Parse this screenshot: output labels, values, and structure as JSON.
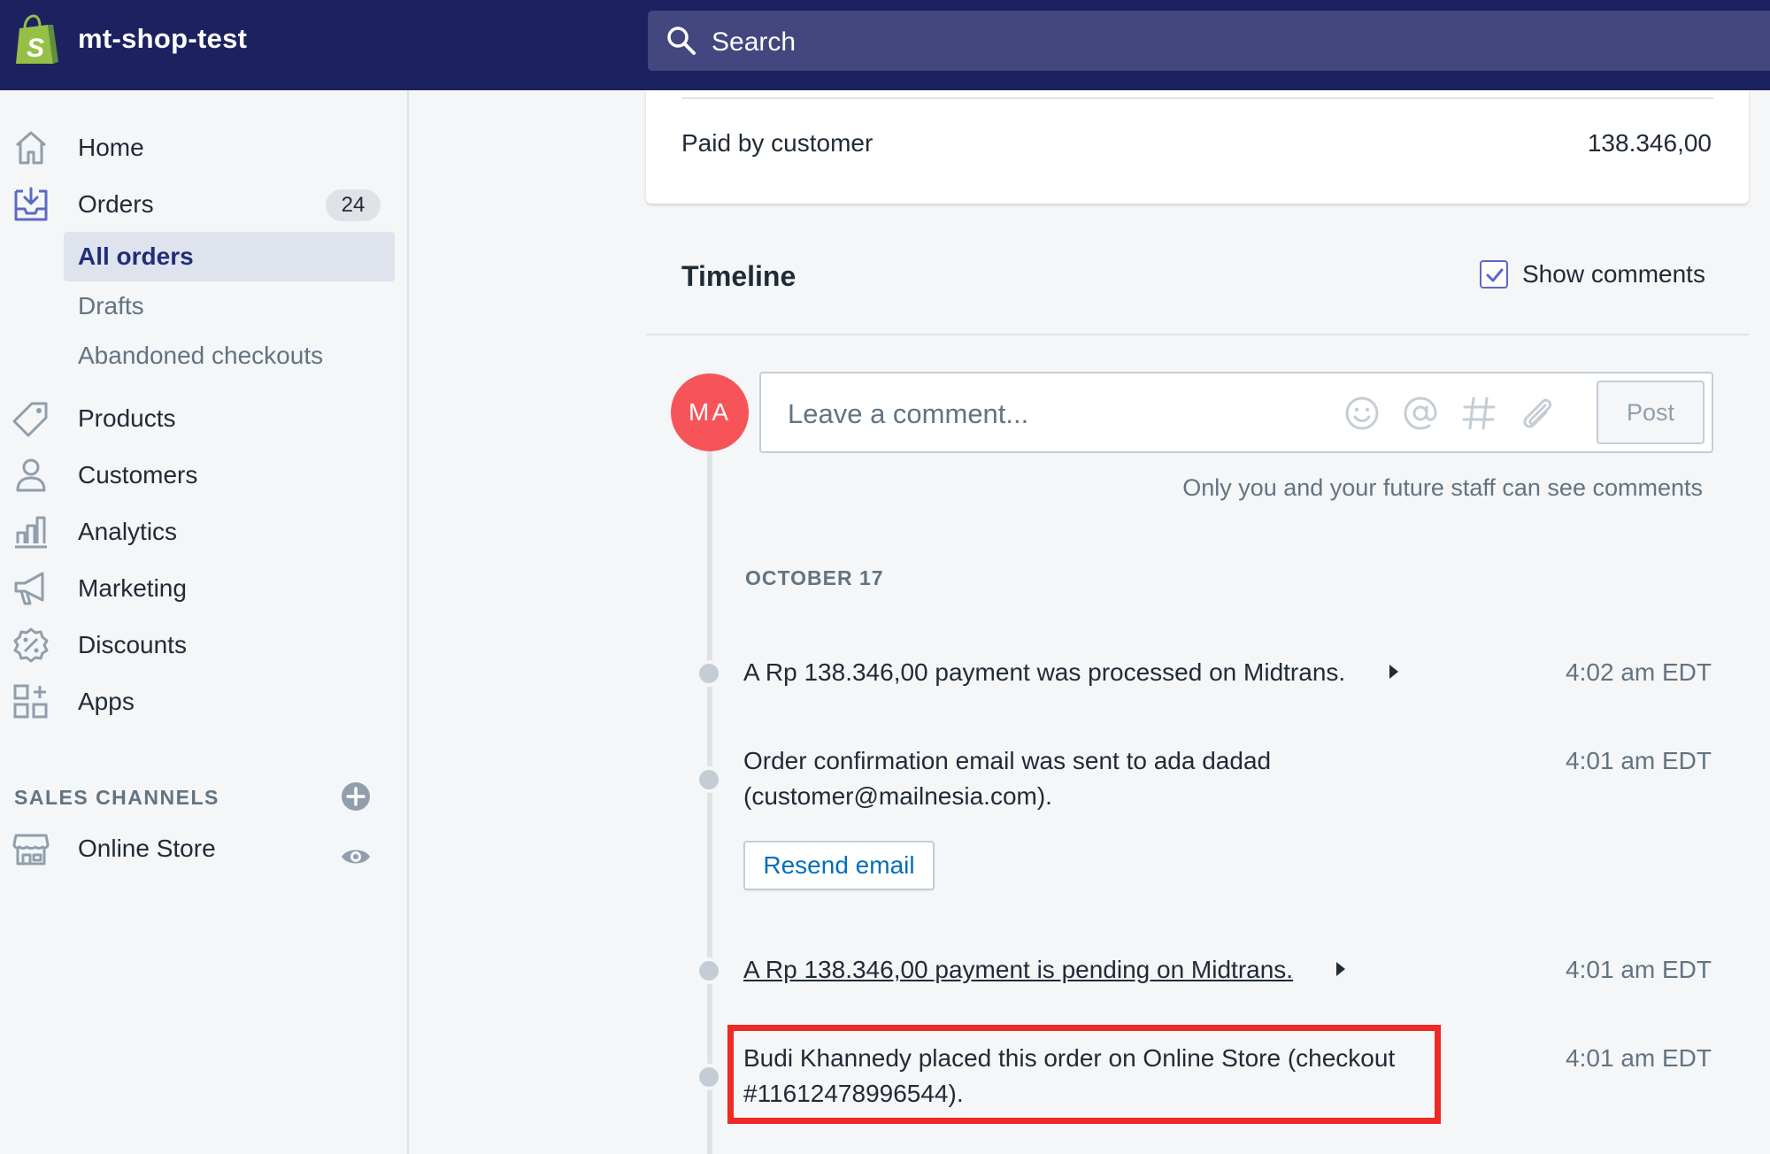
{
  "topbar": {
    "shop_name": "mt-shop-test",
    "search_placeholder": "Search",
    "logo_icon": "shopify-bag-icon"
  },
  "sidebar": {
    "items": [
      {
        "label": "Home",
        "icon": "home-icon"
      },
      {
        "label": "Orders",
        "icon": "orders-inbox-icon",
        "badge": "24"
      },
      {
        "label": "Products",
        "icon": "tag-icon"
      },
      {
        "label": "Customers",
        "icon": "person-icon"
      },
      {
        "label": "Analytics",
        "icon": "bar-chart-icon"
      },
      {
        "label": "Marketing",
        "icon": "megaphone-icon"
      },
      {
        "label": "Discounts",
        "icon": "discount-icon"
      },
      {
        "label": "Apps",
        "icon": "apps-grid-icon"
      }
    ],
    "orders_sub": [
      {
        "label": "All orders",
        "active": true
      },
      {
        "label": "Drafts",
        "active": false
      },
      {
        "label": "Abandoned checkouts",
        "active": false
      }
    ],
    "sales_channels_title": "SALES CHANNELS",
    "online_store": "Online Store"
  },
  "payment_card": {
    "paid_label": "Paid by customer",
    "paid_value": "138.346,00"
  },
  "timeline": {
    "title": "Timeline",
    "show_comments_label": "Show comments",
    "show_comments_checked": true,
    "avatar_initials": "MA",
    "comment_placeholder": "Leave a comment...",
    "post_label": "Post",
    "comment_hint": "Only you and your future staff can see comments",
    "date_label": "OCTOBER 17",
    "events": [
      {
        "text": "A Rp 138.346,00 payment was processed on Midtrans.",
        "time": "4:02 am EDT"
      },
      {
        "text_line1": "Order confirmation email was sent to ada dadad",
        "text_line2": "(customer@mailnesia.com).",
        "time": "4:01 am EDT",
        "button": "Resend email"
      },
      {
        "text": "A Rp 138.346,00 payment is pending on Midtrans.",
        "time": "4:01 am EDT"
      },
      {
        "text_line1": "Budi Khannedy placed this order on Online Store (checkout",
        "text_line2": "#11612478996544).",
        "time": "4:01 am EDT"
      }
    ]
  },
  "colors": {
    "topbar": "#1c2260",
    "search": "#43467f",
    "avatar": "#f7545a",
    "accent": "#5c6ac4",
    "link": "#006fbb",
    "highlight": "#ee2a22"
  }
}
